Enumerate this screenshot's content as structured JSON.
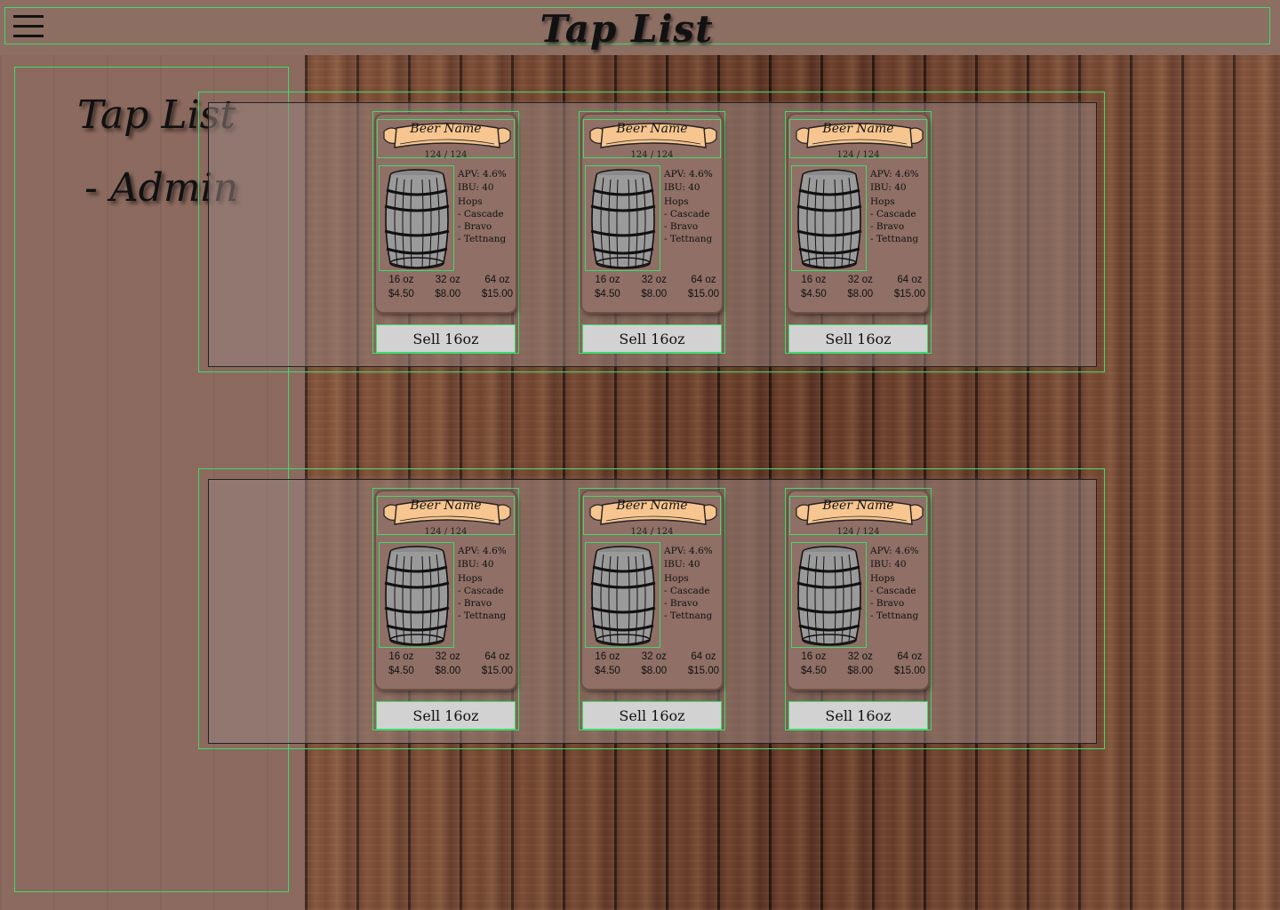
{
  "header": {
    "title": "Tap List"
  },
  "sidebar": {
    "title": "Tap List",
    "subtitle": "- Admin"
  },
  "rows": [
    {
      "cards": [
        {
          "name": "Beer Name",
          "count": "124 / 124",
          "abv": "APV: 4.6%",
          "ibu": "IBU: 40",
          "hops_label": "Hops",
          "hops": [
            "- Cascade",
            "- Bravo",
            "- Tettnang"
          ],
          "sizes": [
            "16 oz",
            "32 oz",
            "64 oz"
          ],
          "prices": [
            "$4.50",
            "$8.00",
            "$15.00"
          ],
          "sell": "Sell 16oz"
        },
        {
          "name": "Beer Name",
          "count": "124 / 124",
          "abv": "APV: 4.6%",
          "ibu": "IBU: 40",
          "hops_label": "Hops",
          "hops": [
            "- Cascade",
            "- Bravo",
            "- Tettnang"
          ],
          "sizes": [
            "16 oz",
            "32 oz",
            "64 oz"
          ],
          "prices": [
            "$4.50",
            "$8.00",
            "$15.00"
          ],
          "sell": "Sell 16oz"
        },
        {
          "name": "Beer Name",
          "count": "124 / 124",
          "abv": "APV: 4.6%",
          "ibu": "IBU: 40",
          "hops_label": "Hops",
          "hops": [
            "- Cascade",
            "- Bravo",
            "- Tettnang"
          ],
          "sizes": [
            "16 oz",
            "32 oz",
            "64 oz"
          ],
          "prices": [
            "$4.50",
            "$8.00",
            "$15.00"
          ],
          "sell": "Sell 16oz"
        }
      ]
    },
    {
      "cards": [
        {
          "name": "Beer Name",
          "count": "124 / 124",
          "abv": "APV: 4.6%",
          "ibu": "IBU: 40",
          "hops_label": "Hops",
          "hops": [
            "- Cascade",
            "- Bravo",
            "- Tettnang"
          ],
          "sizes": [
            "16 oz",
            "32 oz",
            "64 oz"
          ],
          "prices": [
            "$4.50",
            "$8.00",
            "$15.00"
          ],
          "sell": "Sell 16oz"
        },
        {
          "name": "Beer Name",
          "count": "124 / 124",
          "abv": "APV: 4.6%",
          "ibu": "IBU: 40",
          "hops_label": "Hops",
          "hops": [
            "- Cascade",
            "- Bravo",
            "- Tettnang"
          ],
          "sizes": [
            "16 oz",
            "32 oz",
            "64 oz"
          ],
          "prices": [
            "$4.50",
            "$8.00",
            "$15.00"
          ],
          "sell": "Sell 16oz"
        },
        {
          "name": "Beer Name",
          "count": "124 / 124",
          "abv": "APV: 4.6%",
          "ibu": "IBU: 40",
          "hops_label": "Hops",
          "hops": [
            "- Cascade",
            "- Bravo",
            "- Tettnang"
          ],
          "sizes": [
            "16 oz",
            "32 oz",
            "64 oz"
          ],
          "prices": [
            "$4.50",
            "$8.00",
            "$15.00"
          ],
          "sell": "Sell 16oz"
        }
      ]
    }
  ],
  "icons": {
    "menu": "hamburger-menu-icon",
    "keg": "barrel-icon",
    "banner": "scroll-banner-icon"
  },
  "colors": {
    "header_bg": "#8d6e63",
    "banner_fill": "#f7c58f",
    "button_bg": "#d2d2d2",
    "outline": "#3ddc6a"
  }
}
